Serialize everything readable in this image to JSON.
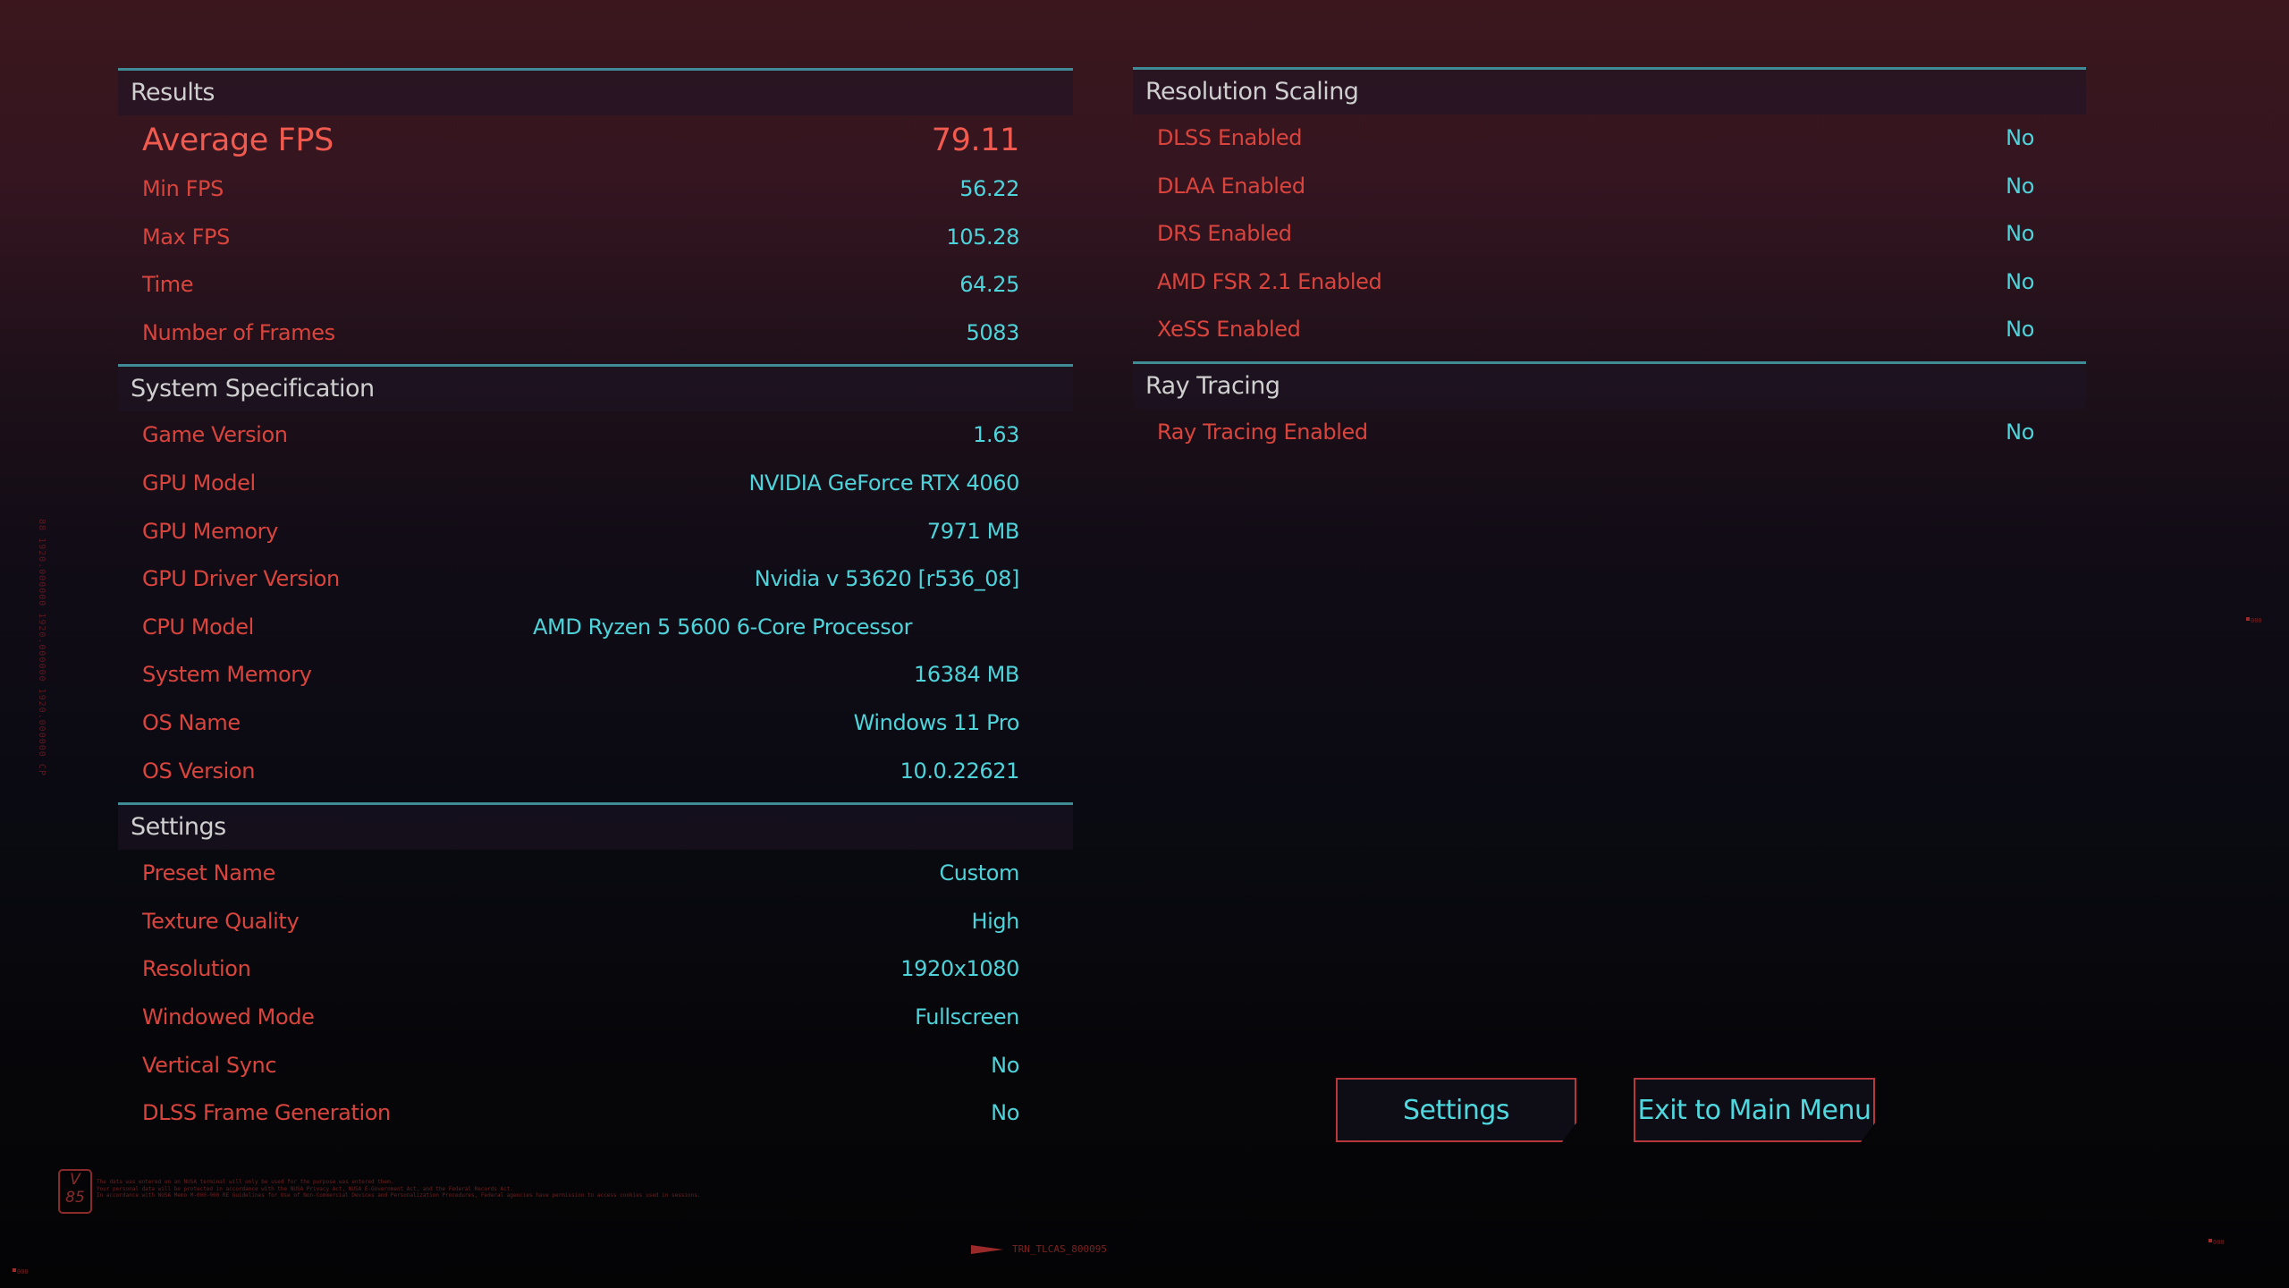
{
  "results": {
    "header": "Results",
    "average": {
      "label": "Average FPS",
      "value": "79.11"
    },
    "rows": [
      {
        "label": "Min FPS",
        "value": "56.22"
      },
      {
        "label": "Max FPS",
        "value": "105.28"
      },
      {
        "label": "Time",
        "value": "64.25"
      },
      {
        "label": "Number of Frames",
        "value": "5083"
      }
    ]
  },
  "system": {
    "header": "System Specification",
    "rows": [
      {
        "label": "Game Version",
        "value": "1.63"
      },
      {
        "label": "GPU Model",
        "value": "NVIDIA GeForce RTX 4060"
      },
      {
        "label": "GPU Memory",
        "value": "7971 MB"
      },
      {
        "label": "GPU Driver Version",
        "value": "Nvidia v 53620 [r536_08]"
      },
      {
        "label": "CPU Model",
        "value": "AMD Ryzen 5 5600 6-Core Processor"
      },
      {
        "label": "System Memory",
        "value": "16384 MB"
      },
      {
        "label": "OS Name",
        "value": "Windows 11 Pro"
      },
      {
        "label": "OS Version",
        "value": "10.0.22621"
      }
    ]
  },
  "settings": {
    "header": "Settings",
    "rows": [
      {
        "label": "Preset Name",
        "value": "Custom"
      },
      {
        "label": "Texture Quality",
        "value": "High"
      },
      {
        "label": "Resolution",
        "value": "1920x1080"
      },
      {
        "label": "Windowed Mode",
        "value": "Fullscreen"
      },
      {
        "label": "Vertical Sync",
        "value": "No"
      },
      {
        "label": "DLSS Frame Generation",
        "value": "No"
      }
    ]
  },
  "resolution_scaling": {
    "header": "Resolution Scaling",
    "rows": [
      {
        "label": "DLSS Enabled",
        "value": "No"
      },
      {
        "label": "DLAA Enabled",
        "value": "No"
      },
      {
        "label": "DRS Enabled",
        "value": "No"
      },
      {
        "label": "AMD FSR 2.1 Enabled",
        "value": "No"
      },
      {
        "label": "XeSS Enabled",
        "value": "No"
      }
    ]
  },
  "ray_tracing": {
    "header": "Ray Tracing",
    "rows": [
      {
        "label": "Ray Tracing Enabled",
        "value": "No"
      }
    ]
  },
  "buttons": {
    "settings": "Settings",
    "exit": "Exit to Main Menu"
  },
  "footer": {
    "badge_top": "V",
    "badge_bottom": "85",
    "fineprint": [
      "The data was entered on an NUSA terminal will only be used for the purpose was entered them.",
      "Your personal data will be protected in accordance with the NUSA Privacy Act, NUSA E-Government Act, and the Federal Records Act.",
      "In accordance with NUSA Memo M-000-000 RE Guidelines for Use of Non-Commercial Devices and Personalization Procedures, Federal agencies have permission to access cookies used in sessions."
    ],
    "tag": "TRN_TLCAS_800095",
    "vertical_text": "88 1920.000000 1920.000000 1920.000000 CP",
    "corner_mark": "000"
  },
  "colors": {
    "label": "#d9443d",
    "value": "#4fd3da",
    "highlight": "#f05a4f",
    "section_line": "#3f8c96",
    "button_border": "#b8373a"
  }
}
